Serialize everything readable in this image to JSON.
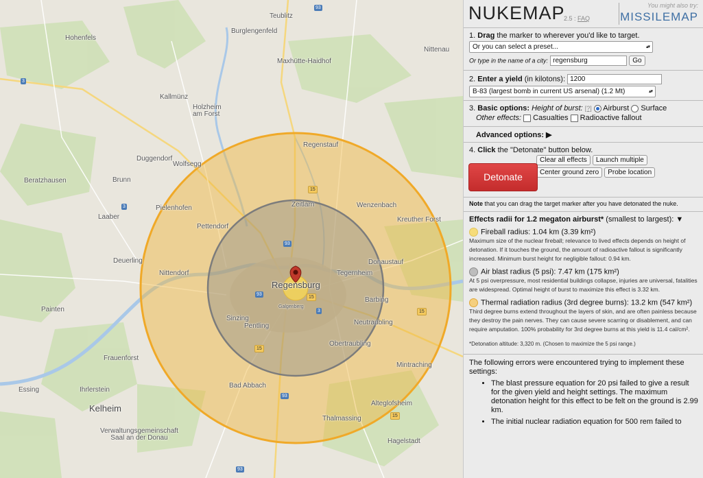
{
  "map": {
    "towns_big": [
      {
        "name": "Regensburg"
      }
    ],
    "towns_mid": [
      {
        "name": "Teublitz"
      },
      {
        "name": "Burglengenfeld"
      },
      {
        "name": "Hohenfels"
      },
      {
        "name": "Maxhütte-Haidhof"
      },
      {
        "name": "Nittenau"
      },
      {
        "name": "Kallmünz"
      },
      {
        "name": "Holzheim\nam Forst"
      },
      {
        "name": "Regenstauf"
      },
      {
        "name": "Duggendorf"
      },
      {
        "name": "Wolfsegg"
      },
      {
        "name": "Beratzhausen"
      },
      {
        "name": "Brunn"
      },
      {
        "name": "Pielenhofen"
      },
      {
        "name": "Laaber"
      },
      {
        "name": "Zeitlarn"
      },
      {
        "name": "Wenzenbach"
      },
      {
        "name": "Kreuther Forst"
      },
      {
        "name": "Pettendorf"
      },
      {
        "name": "Deuerling"
      },
      {
        "name": "Nittendorf"
      },
      {
        "name": "Donaustauf"
      },
      {
        "name": "Tegernheim"
      },
      {
        "name": "Barbing"
      },
      {
        "name": "Painten"
      },
      {
        "name": "Sinzing"
      },
      {
        "name": "Pentling"
      },
      {
        "name": "Neutraubling"
      },
      {
        "name": "Obertraubling"
      },
      {
        "name": "Frauenforst"
      },
      {
        "name": "Mintraching"
      },
      {
        "name": "Essing"
      },
      {
        "name": "Ihrlerstein"
      },
      {
        "name": "Bad Abbach"
      },
      {
        "name": "Kelheim"
      },
      {
        "name": "Alteglofsheim"
      },
      {
        "name": "Thalmassing"
      },
      {
        "name": "Verwaltungsgemeinschaft\nSaal an der Donau"
      },
      {
        "name": "Hagelstadt"
      },
      {
        "name": "Galgenberg"
      }
    ],
    "shields": [
      "93",
      "3",
      "15",
      "3",
      "15",
      "93",
      "3",
      "93",
      "15",
      "93",
      "15",
      "93",
      "15"
    ]
  },
  "panel": {
    "logo": "NUKEMAP",
    "version": "2.5",
    "faq": "FAQ",
    "try_label": "You might also try:",
    "missilemap": "MISSILEMAP",
    "step1_num": "1.",
    "step1_bold": "Drag",
    "step1_rest": "the marker to wherever you'd like to target.",
    "preset_value": "Or you can select a preset...",
    "city_label": "Or type in the name of a city:",
    "city_value": "regensburg",
    "go_label": "Go",
    "step2_num": "2.",
    "step2_bold": "Enter a yield",
    "step2_rest": "(in kilotons):",
    "yield_value": "1200",
    "bomb_value": "B-83 (largest bomb in current US arsenal) (1.2 Mt)",
    "step3_num": "3.",
    "step3_bold": "Basic options:",
    "height_label": "Height of burst:",
    "help_mark": "[?]",
    "airburst": "Airburst",
    "surface": "Surface",
    "other_label": "Other effects:",
    "casualties": "Casualties",
    "fallout": "Radioactive fallout",
    "advanced": "Advanced options: ▶",
    "step4_num": "4.",
    "step4_bold": "Click",
    "step4_rest": "the \"Detonate\" button below.",
    "detonate": "Detonate",
    "clear": "Clear all effects",
    "launch": "Launch multiple",
    "center": "Center ground zero",
    "probe": "Probe location",
    "note_bold": "Note",
    "note_rest": "that you can drag the target marker after you have detonated the nuke.",
    "effects_title": "Effects radii for 1.2 megaton airburst*",
    "effects_order": "(smallest to largest): ▼",
    "fireball_title": "Fireball radius: 1.04 km (3.39 km²)",
    "fireball_desc": "Maximum size of the nuclear fireball; relevance to lived effects depends on height of detonation. If it touches the ground, the amount of radioactive fallout is significantly increased. Minimum burst height for negligible fallout: 0.94 km.",
    "airblast_title": "Air blast radius (5 psi): 7.47 km (175 km²)",
    "airblast_desc": "At 5 psi overpressure, most residential buildings collapse, injuries are universal, fatalities are widespread. Optimal height of burst to maximize this effect is 3.32 km.",
    "thermal_title": "Thermal radiation radius (3rd degree burns): 13.2 km (547 km²)",
    "thermal_desc": "Third degree burns extend throughout the layers of skin, and are often painless because they destroy the pain nerves. They can cause severe scarring or disablement, and can require amputation. 100% probability for 3rd degree burns at this yield is 11.4 cal/cm².",
    "altitude": "*Detonation altitude: 3,320 m. (Chosen to maximize the 5 psi range.)",
    "errors_intro": "The following errors were encountered trying to implement these settings:",
    "error1": "The blast pressure equation for 20 psi failed to give a result for the given yield and height settings. The maximum detonation height for this effect to be felt on the ground is 2.99 km.",
    "error2": "The initial nuclear radiation equation for 500 rem failed to"
  },
  "colors": {
    "fireball": "#f2d35a",
    "airblast": "#8a8a8a",
    "thermal": "#f0b53c",
    "detonate": "#d43a3a",
    "missilemap": "#3e6fa4"
  }
}
